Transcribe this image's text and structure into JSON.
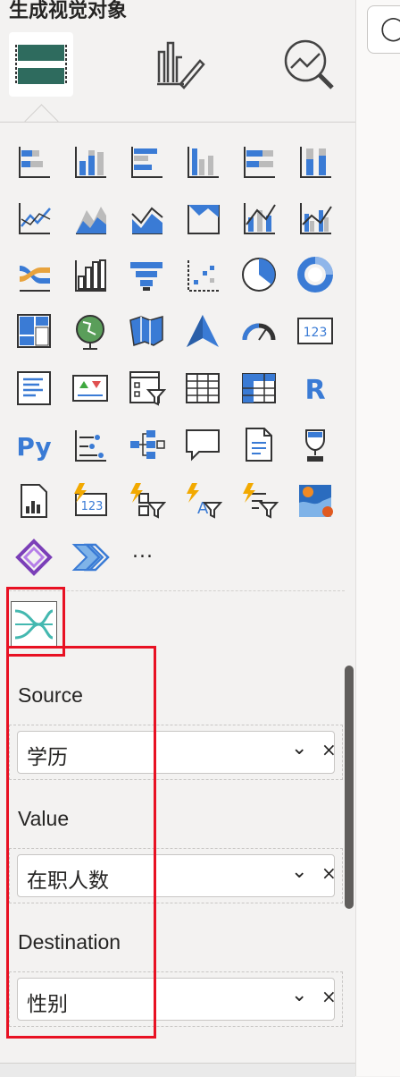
{
  "panel": {
    "title": "生成视觉对象",
    "tabs": [
      {
        "name": "build-visual-icon",
        "selected": true
      },
      {
        "name": "format-visual-icon",
        "selected": false
      },
      {
        "name": "analytics-icon",
        "selected": false
      }
    ]
  },
  "gallery": {
    "more_label": "...",
    "accent": "#3a7bd5",
    "icons": [
      "stacked-bar-icon",
      "stacked-column-icon",
      "clustered-bar-icon",
      "clustered-column-icon",
      "100-stacked-bar-icon",
      "100-stacked-column-icon",
      "line-chart-icon",
      "area-chart-icon",
      "stacked-area-icon",
      "100-stacked-area-icon",
      "line-stacked-column-icon",
      "line-clustered-column-icon",
      "ribbon-chart-icon",
      "waterfall-chart-icon",
      "funnel-chart-icon",
      "scatter-chart-icon",
      "pie-chart-icon",
      "donut-chart-icon",
      "treemap-icon",
      "globe-map-icon",
      "filled-map-icon",
      "azure-map-icon",
      "gauge-icon",
      "card-icon",
      "multi-row-card-icon",
      "kpi-icon",
      "slicer-icon",
      "table-icon",
      "matrix-icon",
      "r-visual-icon",
      "python-visual-icon",
      "key-influencers-icon",
      "decomposition-tree-icon",
      "qa-icon",
      "smart-narrative-icon",
      "goals-icon",
      "paginated-report-icon",
      "power-automate-card-icon",
      "power-automate-slicer-icon",
      "power-automate-text-icon",
      "power-automate-filter-icon",
      "arcgis-map-icon",
      "power-apps-icon",
      "power-automate-icon"
    ],
    "r_label": "R",
    "py_label": "Py",
    "card_label": "123"
  },
  "custom_visual": {
    "name": "sankey-custom-visual-icon",
    "color": "#44b8b0"
  },
  "fields": [
    {
      "label": "Source",
      "value": "学历"
    },
    {
      "label": "Value",
      "value": "在职人数"
    },
    {
      "label": "Destination",
      "value": "性别"
    }
  ],
  "controls": {
    "chevron": "⌄",
    "remove": "×"
  },
  "right_pane": {
    "button_glyph": "◯"
  }
}
